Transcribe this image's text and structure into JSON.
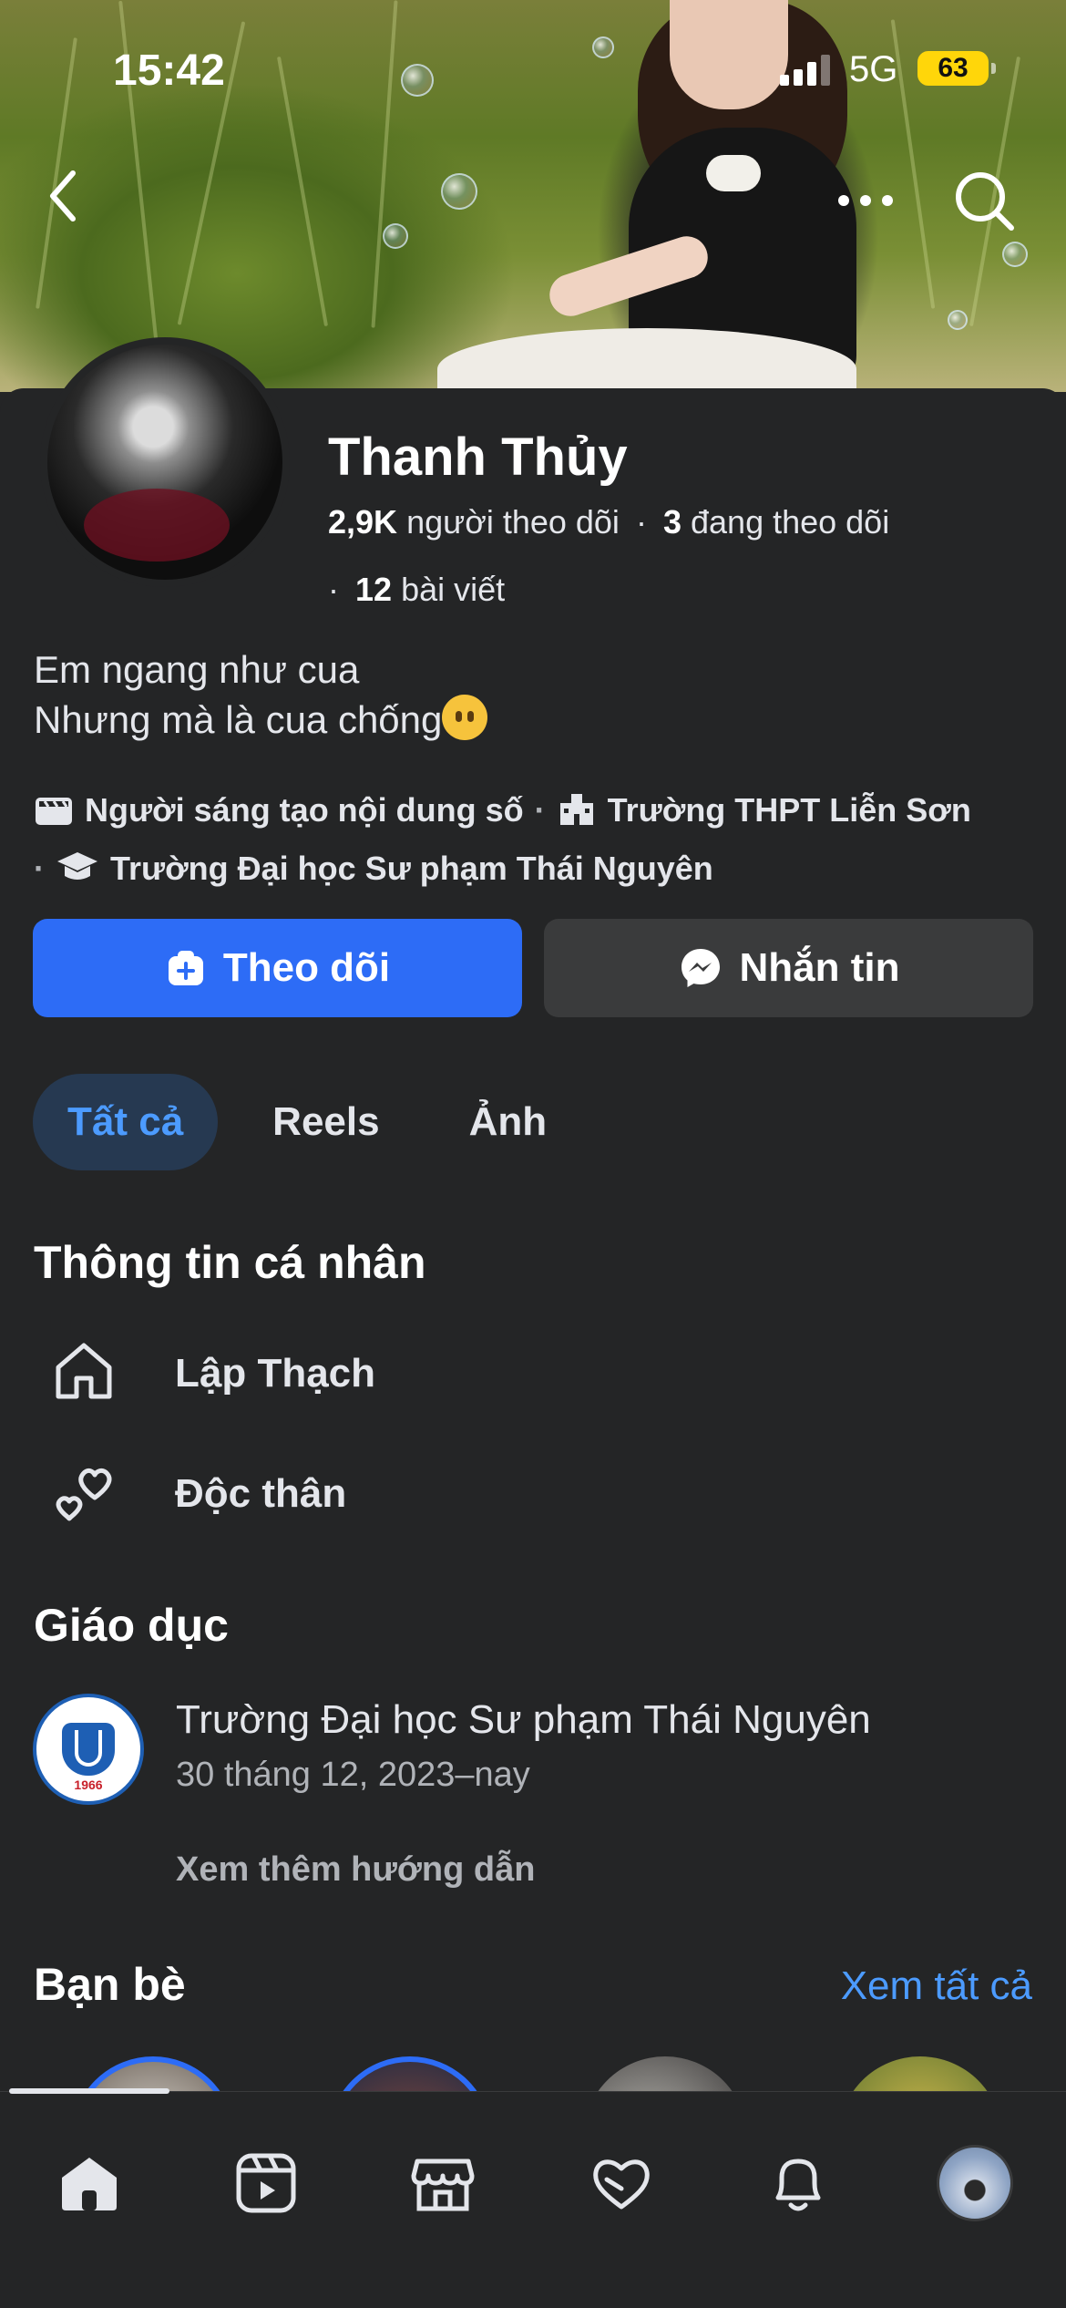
{
  "status_bar": {
    "time": "15:42",
    "network": "5G",
    "battery": "63"
  },
  "profile": {
    "name": "Thanh Thủy",
    "followers_count": "2,9K",
    "followers_label": "người theo dõi",
    "following_count": "3",
    "following_label": "đang theo dõi",
    "posts_count": "12",
    "posts_label": "bài viết",
    "bio_line1": "Em ngang như cua",
    "bio_line2": "Nhưng mà là cua chống",
    "meta": {
      "creator": "Người sáng tạo nội dung số",
      "school1": "Trường THPT Liễn Sơn",
      "school2": "Trường Đại học Sư phạm Thái Nguyên"
    }
  },
  "actions": {
    "follow_label": "Theo dõi",
    "message_label": "Nhắn tin"
  },
  "tabs": [
    {
      "label": "Tất cả",
      "active": true
    },
    {
      "label": "Reels",
      "active": false
    },
    {
      "label": "Ảnh",
      "active": false
    }
  ],
  "personal_info": {
    "title": "Thông tin cá nhân",
    "hometown": "Lập Thạch",
    "relationship": "Độc thân"
  },
  "education": {
    "title": "Giáo dục",
    "school": "Trường Đại học Sư phạm Thái Nguyên",
    "date": "30 tháng 12, 2023–nay",
    "logo_year": "1966",
    "see_more": "Xem thêm hướng dẫn"
  },
  "friends": {
    "title": "Bạn bè",
    "see_all": "Xem tất cả"
  },
  "bottom_nav": [
    "home-icon",
    "reels-icon",
    "marketplace-icon",
    "dating-icon",
    "notifications-icon",
    "profile-avatar"
  ],
  "colors": {
    "accent": "#2d6cf6",
    "link": "#4c9bff",
    "background": "#242526",
    "battery": "#ffd60a"
  }
}
